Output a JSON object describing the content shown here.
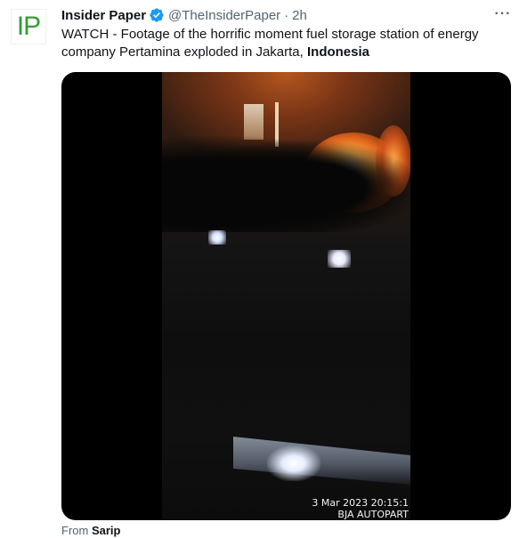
{
  "author": {
    "avatar_text": "IP",
    "display_name": "Insider Paper",
    "handle": "@TheInsiderPaper",
    "separator": "·",
    "time": "2h",
    "verified": true
  },
  "more_menu": {
    "label": "···",
    "icon": "more-horizontal-icon"
  },
  "tweet": {
    "text_main": "WATCH - Footage of the horrific moment fuel storage station of energy company Pertamina exploded in Jakarta, ",
    "text_bold": "Indonesia"
  },
  "media": {
    "watermark_line1": "3 Mar 2023 20:15:1",
    "watermark_line2": "BJA AUTOPART"
  },
  "source": {
    "prefix": "From",
    "name": "Sarip"
  },
  "colors": {
    "brand_green": "#3a9a3a",
    "verified_blue": "#1d9bf0",
    "text_primary": "#0f1419",
    "text_secondary": "#536471"
  }
}
